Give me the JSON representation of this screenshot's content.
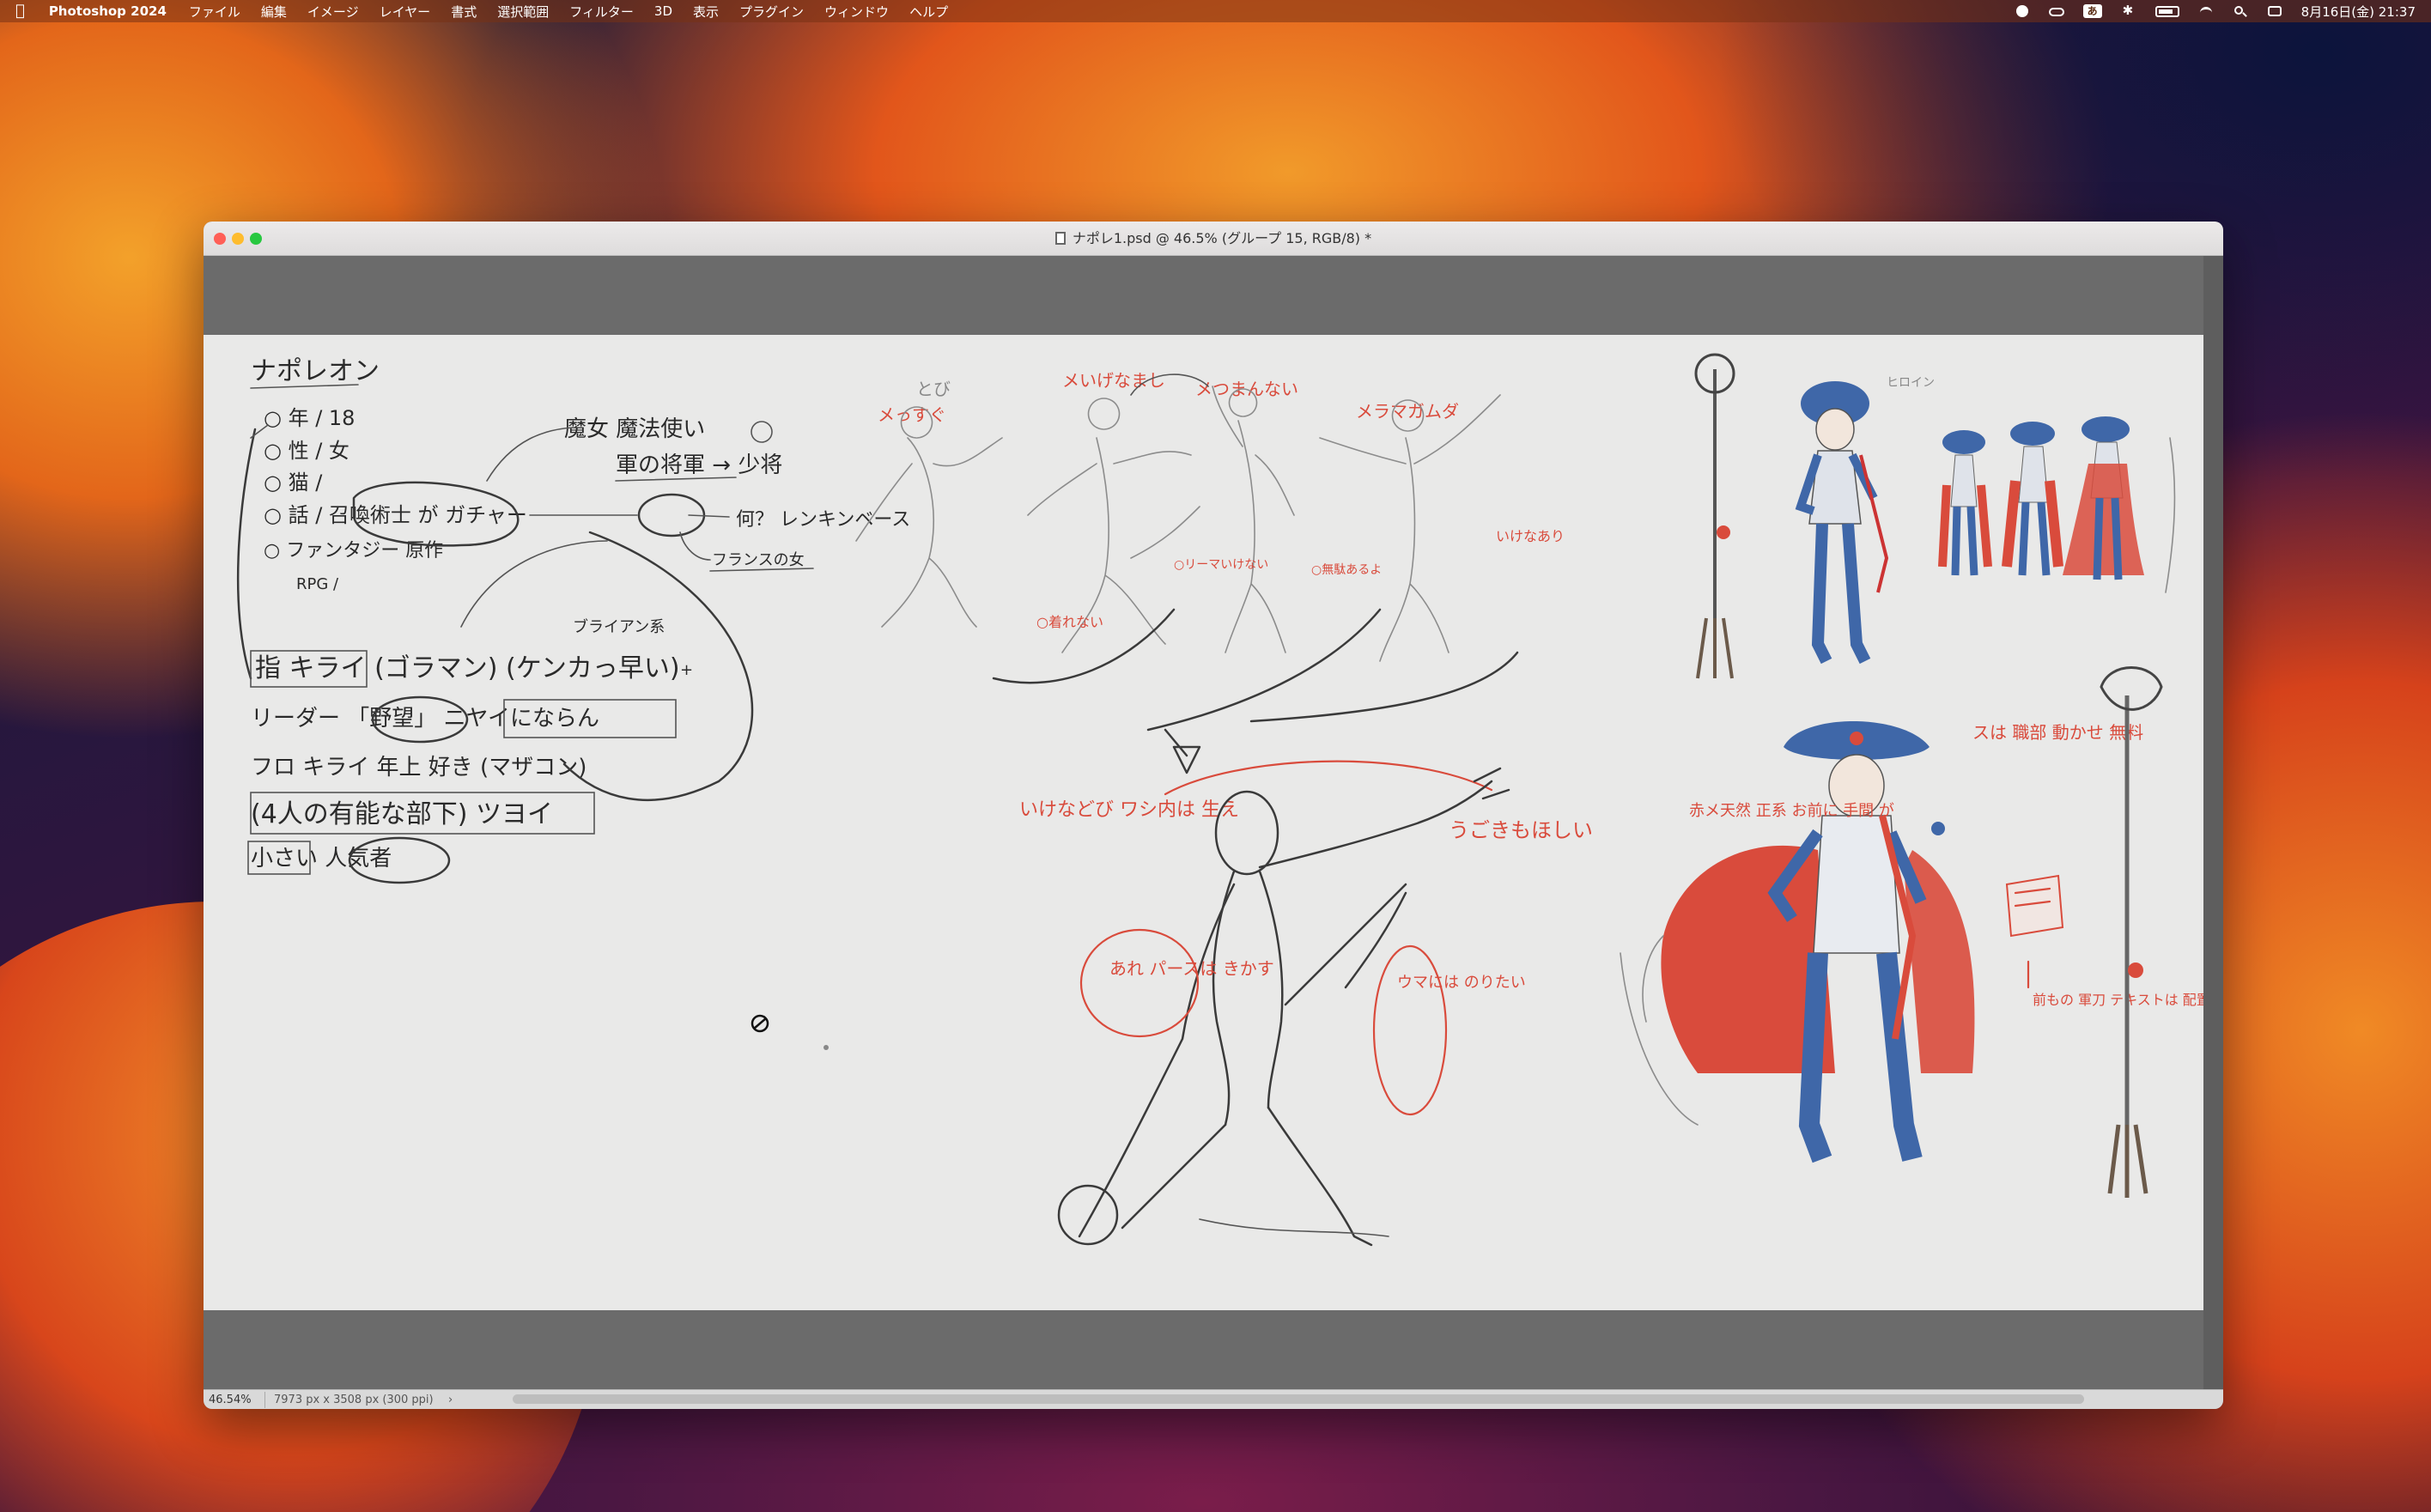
{
  "menubar": {
    "apple_icon": "apple-logo",
    "app_name": "Photoshop 2024",
    "items": [
      "ファイル",
      "編集",
      "イメージ",
      "レイヤー",
      "書式",
      "選択範囲",
      "フィルター",
      "3D",
      "表示",
      "プラグイン",
      "ウィンドウ",
      "ヘルプ"
    ],
    "input_source": "あ",
    "clock": "8月16日(金) 21:37"
  },
  "window": {
    "title": "ナポレ1.psd @ 46.5% (グループ 15, RGB/8) *"
  },
  "statusbar": {
    "zoom": "46.54%",
    "doc_info": "7973 px x 3508 px (300 ppi)",
    "arrow": "›"
  },
  "canvas": {
    "notes": {
      "title": "ナポレオン",
      "line_age": "○ 年 / 18",
      "line_sex": "○ 性 / 女",
      "line_3": "○ 猫 /",
      "line_4": "○ 話 / 召喚術士 が ガチャー",
      "line_5": "○ ファンタジー 原作",
      "line_6": "RPG /",
      "magic": "魔女 魔法使い",
      "army": "軍の将軍 → 少将",
      "what": "何？ レンキンベース",
      "france": "フランスの女",
      "plus": "+",
      "block_1": "指 キライ (ゴラマン) (ケンカっ早い)",
      "block_2": "リーダー 「野望」 ニヤイにならん",
      "block_3": "フロ キライ 年上 好き (マザコン)",
      "block_4": "(4人の有能な部下) ツヨイ",
      "block_5": "小さい 人気者",
      "small_note": "ブライアン系"
    },
    "red_notes": {
      "pose1": "メっすぐ",
      "pose2": "メいげなまし",
      "pose3": "メつまんない",
      "pose4": "メラマガムダ",
      "to": "とび",
      "note_a": "○着れない",
      "note_b": "○リーマいけない",
      "note_c": "○無駄あるよ",
      "note_d": "いけなあり",
      "big_left": "いけなどび ワシ内は 生え",
      "big_right": "うごきもほしい",
      "circle_left": "あれ パースは きかす",
      "circle_right": "ウマには のりたい",
      "char_left": "赤メ天然 正系 お前に 手間 が",
      "char_right": "スは 職部 動かせ 無料",
      "side": "前もの 軍刀 テキストは 配置"
    },
    "sketch_label": "ヒロイン",
    "colors": {
      "red": "#d94b3c",
      "blue": "#3f67a8",
      "pencil": "#3a3a3a"
    }
  }
}
